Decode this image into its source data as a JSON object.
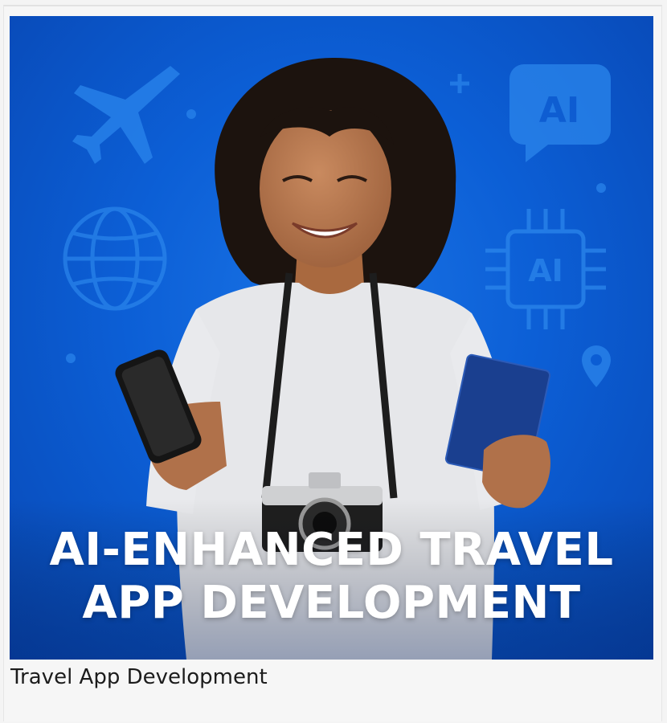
{
  "hero": {
    "background_color": "#0c5fd6",
    "accent_icon_color": "#2b86ec",
    "icons": [
      "airplane-icon",
      "globe-icon",
      "ai-chat-icon",
      "ai-chip-icon",
      "location-pin-icon",
      "plus-icon"
    ],
    "headline_line1": "AI-ENHANCED TRAVEL",
    "headline_line2": "APP DEVELOPMENT",
    "ai_chat_text": "AI",
    "ai_chip_text": "AI"
  },
  "caption": "Travel App Development"
}
